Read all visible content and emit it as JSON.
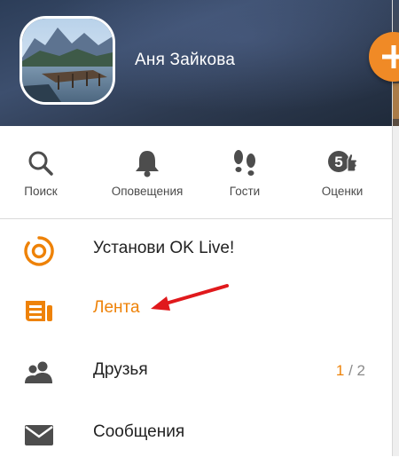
{
  "colors": {
    "accent": "#ee8208",
    "arrow": "#e0191c",
    "icon_gray": "#4d4d4d"
  },
  "header": {
    "user_name": "Аня Зайкова",
    "avatar": "avatar-photo-landscape",
    "fab_icon": "plus-icon"
  },
  "quick_actions": [
    {
      "label": "Поиск",
      "icon": "search-icon"
    },
    {
      "label": "Оповещения",
      "icon": "bell-icon"
    },
    {
      "label": "Гости",
      "icon": "footprints-icon"
    },
    {
      "label": "Оценки",
      "icon": "rating-five-icon"
    }
  ],
  "menu": {
    "items": [
      {
        "label": "Установи OK Live!",
        "icon": "ok-live-icon"
      },
      {
        "label": "Лента",
        "icon": "feed-icon",
        "active": true
      },
      {
        "label": "Друзья",
        "icon": "friends-icon",
        "counter_new": "1",
        "counter_sep": " / ",
        "counter_total": "2"
      },
      {
        "label": "Сообщения",
        "icon": "envelope-icon"
      }
    ]
  }
}
